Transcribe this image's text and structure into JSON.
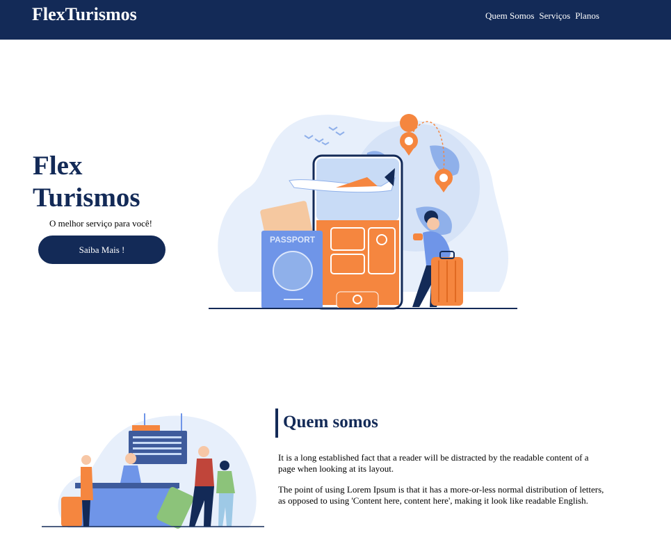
{
  "header": {
    "brand": "FlexTurismos",
    "nav": [
      "Quem Somos",
      "Serviços",
      "Planos"
    ]
  },
  "hero": {
    "title": "Flex Turismos",
    "subtitle": "O melhor serviço para você!",
    "button_label": "Saiba Mais !",
    "passport_label": "PASSPORT"
  },
  "about": {
    "heading": "Quem somos",
    "paragraphs": [
      "It is a long established fact that a reader will be distracted by the readable content of a page when looking at its layout.",
      "The point of using Lorem Ipsum is that it has a more-or-less normal distribution of letters, as opposed to using 'Content here, content here', making it look like readable English."
    ]
  },
  "colors": {
    "navy": "#132a57",
    "orange": "#f5863f",
    "blue": "#6f95e8",
    "light_blue": "#e7effb"
  }
}
